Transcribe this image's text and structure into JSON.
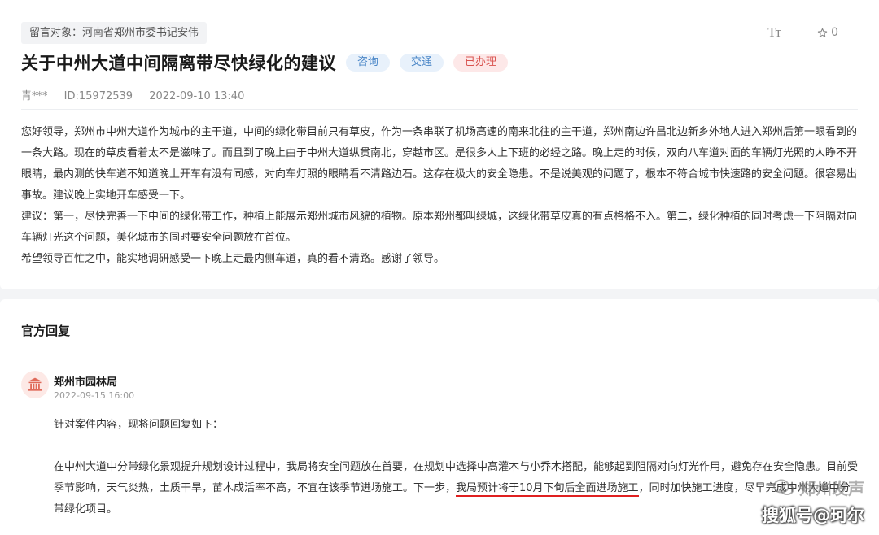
{
  "header": {
    "target": "留言对象：河南省郑州市委书记安伟",
    "font_toggle": "Tт",
    "fav_count": "0",
    "title": "关于中州大道中间隔离带尽快绿化的建议",
    "tags": [
      "咨询",
      "交通",
      "已办理"
    ],
    "author": "青***",
    "id": "ID:15972539",
    "time": "2022-09-10 13:40"
  },
  "content": {
    "paragraphs": [
      "您好领导，郑州市中州大道作为城市的主干道，中间的绿化带目前只有草皮，作为一条串联了机场高速的南来北往的主干道，郑州南边许昌北边新乡外地人进入郑州后第一眼看到的一条大路。现在的草皮看着太不是滋味了。而且到了晚上由于中州大道纵贯南北，穿越市区。是很多人上下班的必经之路。晚上走的时候，双向八车道对面的车辆灯光照的人睁不开眼睛，最内测的快车道不知道晚上开车有没有同感，对向车灯照的眼睛看不清路边石。这存在极大的安全隐患。不是说美观的问题了，根本不符合城市快速路的安全问题。很容易出事故。建议晚上实地开车感受一下。",
      "建议：第一，尽快完善一下中间的绿化带工作，种植上能展示郑州城市风貌的植物。原本郑州都叫绿城，这绿化带草皮真的有点格格不入。第二，绿化种植的同时考虑一下阻隔对向车辆灯光这个问题，美化城市的同时要安全问题放在首位。",
      "希望领导百忙之中，能实地调研感受一下晚上走最内侧车道，真的看不清路。感谢了领导。"
    ]
  },
  "reply": {
    "heading": "官方回复",
    "org": "郑州市园林局",
    "time": "2022-09-15 16:00",
    "intro": "针对案件内容，现将问题回复如下：",
    "body_before": "在中州大道中分带绿化景观提升规划设计过程中，我局将安全问题放在首要，在规划中选择中高灌木与小乔木搭配，能够起到阻隔对向灯光作用，避免存在安全隐患。目前受季节影响，天气炎热，土质干旱，苗木成活率不高，不宜在该季节进场施工。下一步，",
    "body_highlight": "我局预计将于10月下旬后全面进场施工",
    "body_after": "，同时加快施工进度，尽早完成中州大道中分带绿化项目。"
  },
  "watermark": {
    "small": "郑州发声",
    "big": "搜狐号@珂尔"
  },
  "colors": {
    "tag_blue": "#4a86c7",
    "tag_red": "#d9534f",
    "highlight_underline": "#e02020"
  }
}
